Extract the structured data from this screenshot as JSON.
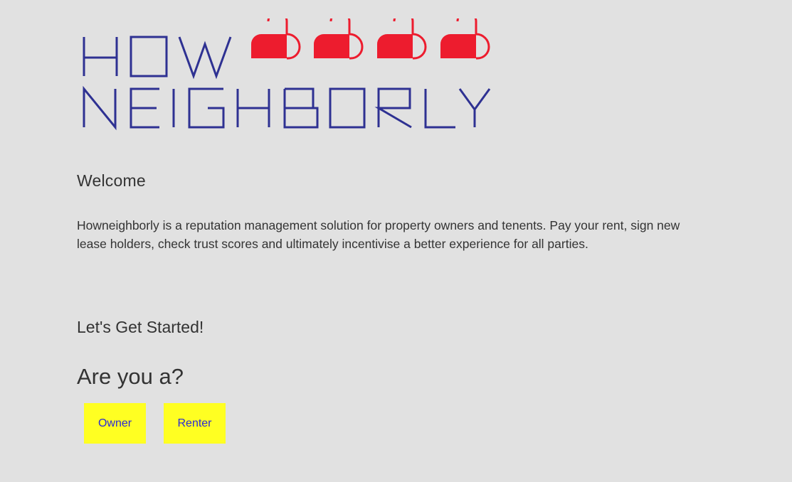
{
  "brand": {
    "logo_line1": "HOW",
    "logo_line2": "NEIGHBORLY",
    "logo_text_color": "#2e3192",
    "heart_color": "#ed1c2e",
    "heart_count": 4
  },
  "welcome": {
    "heading": "Welcome",
    "intro": "Howneighborly is a reputation management solution for property owners and tenents. Pay your rent, sign new lease holders, check trust scores and ultimately incentivise a better experience for all parties."
  },
  "get_started": {
    "heading": "Let's Get Started!",
    "question": "Are you a?",
    "buttons": [
      {
        "label": "Owner"
      },
      {
        "label": "Renter"
      }
    ]
  },
  "colors": {
    "background": "#e1e1e1",
    "button_bg": "#ffff22",
    "button_text": "#2a2ad6"
  }
}
